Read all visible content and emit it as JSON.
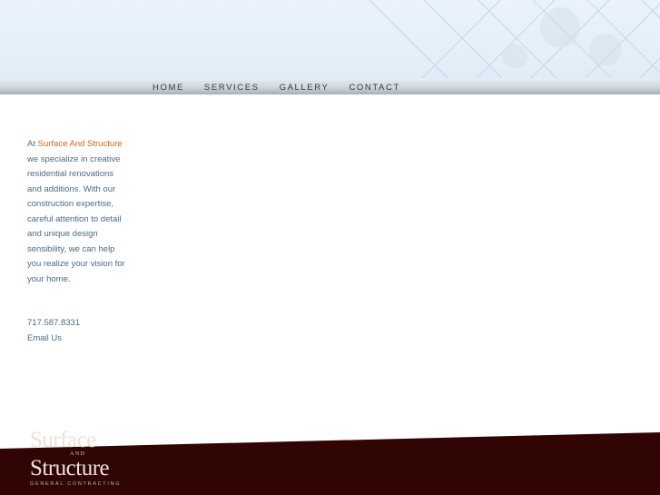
{
  "nav": {
    "items": [
      {
        "label": "HOME"
      },
      {
        "label": "SERVICES"
      },
      {
        "label": "GALLERY"
      },
      {
        "label": "CONTACT"
      }
    ]
  },
  "intro": {
    "prefix": "At ",
    "brand": "Surface And Structure",
    "body": " we specialize in creative residential renovations and additions. With our construction expertise, careful attention to detail and unique design sensibility, we can help you realize your vision for your home."
  },
  "contact": {
    "phone": "717.587.8331",
    "email": "Email Us"
  },
  "logo": {
    "line1": "Surface",
    "and": "AND",
    "line2": "Structure",
    "subtitle": "GENERAL CONTRACTING"
  },
  "colors": {
    "accent": "#d4631c",
    "text": "#4d6a80",
    "footer": "#300504"
  }
}
